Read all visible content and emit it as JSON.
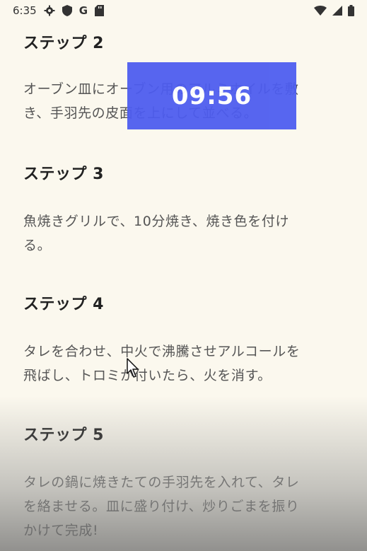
{
  "status_bar": {
    "time": "6:35",
    "left_icons": [
      "gear-icon",
      "shield-icon",
      "google-icon",
      "sd-card-icon"
    ],
    "google_letter": "G",
    "right_icons": [
      "wifi-icon",
      "signal-icon",
      "battery-icon"
    ]
  },
  "timer": {
    "value": "09:56",
    "color": "#4d5cf0"
  },
  "steps": [
    {
      "title": "ステップ 2",
      "body_lines": [
        "オーブン皿にオーブン用のアルミホイルを敷",
        "き、手羽先の皮面を上にして並べる。"
      ]
    },
    {
      "title": "ステップ 3",
      "body_lines": [
        "魚焼きグリルで、10分焼き、焼き色を付け",
        "る。"
      ]
    },
    {
      "title": "ステップ 4",
      "body_lines": [
        "タレを合わせ、中火で沸騰させアルコールを",
        "飛ばし、トロミが付いたら、火を消す。"
      ]
    },
    {
      "title": "ステップ 5",
      "body_lines": [
        "タレの鍋に焼きたての手羽先を入れて、タレ",
        "を絡ませる。皿に盛り付け、炒りごまを振り",
        "かけて完成!"
      ]
    }
  ]
}
